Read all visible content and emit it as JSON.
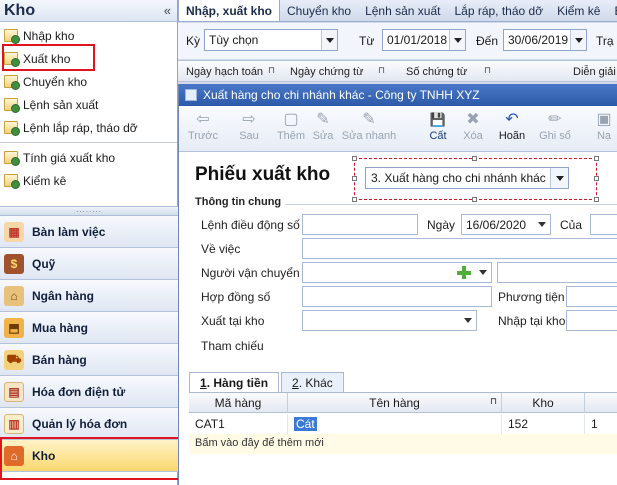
{
  "sidebar": {
    "title": "Kho",
    "collapse": "«",
    "items": [
      {
        "label": "Nhập kho"
      },
      {
        "label": "Xuất kho"
      },
      {
        "label": "Chuyển kho"
      },
      {
        "label": "Lệnh sản xuất"
      },
      {
        "label": "Lệnh lắp ráp, tháo dỡ"
      },
      {
        "label": "Tính giá xuất kho"
      },
      {
        "label": "Kiểm kê"
      }
    ],
    "grip": "........",
    "nav": [
      {
        "label": "Bàn làm việc"
      },
      {
        "label": "Quỹ"
      },
      {
        "label": "Ngân hàng"
      },
      {
        "label": "Mua hàng"
      },
      {
        "label": "Bán hàng"
      },
      {
        "label": "Hóa đơn điện tử"
      },
      {
        "label": "Quản lý hóa đơn"
      },
      {
        "label": "Kho"
      }
    ]
  },
  "tabs": [
    "Nhập, xuất kho",
    "Chuyển kho",
    "Lệnh sản xuất",
    "Lắp ráp, tháo dỡ",
    "Kiểm kê",
    "Báo"
  ],
  "filter": {
    "period_label": "Kỳ",
    "period_value": "Tùy chọn",
    "from_label": "Từ",
    "from_value": "01/01/2018",
    "to_label": "Đến",
    "to_value": "30/06/2019",
    "status_label": "Trạ"
  },
  "grid_headers": [
    "Ngày hạch toán",
    "Ngày chứng từ",
    "Số chứng từ",
    "Diễn giải"
  ],
  "form": {
    "window_title": "Xuất hàng cho chi nhánh khác - Công ty TNHH XYZ",
    "toolbar": [
      {
        "label": "Trước",
        "glyph": "⇦"
      },
      {
        "label": "Sau",
        "glyph": "⇨"
      },
      {
        "label": "Thêm",
        "glyph": "▢"
      },
      {
        "label": "Sửa",
        "glyph": "✎"
      },
      {
        "label": "Sửa nhanh",
        "glyph": "✎"
      },
      {
        "label": "Cất",
        "glyph": "💾"
      },
      {
        "label": "Xóa",
        "glyph": "✖"
      },
      {
        "label": "Hoãn",
        "glyph": "↶"
      },
      {
        "label": "Ghi sổ",
        "glyph": "✏"
      },
      {
        "label": "Nạ",
        "glyph": "▣"
      }
    ],
    "heading": "Phiếu xuất kho",
    "type_value": "3. Xuất hàng cho chi nhánh khác",
    "section_title": "Thông tin chung",
    "fields": {
      "order_label": "Lệnh điều động số",
      "date_label": "Ngày",
      "date_value": "16/06/2020",
      "of_label": "Của",
      "subject_label": "Về việc",
      "carrier_label": "Người vận chuyển",
      "contract_label": "Hợp đồng số",
      "vehicle_label": "Phương tiện",
      "from_stock_label": "Xuất tại kho",
      "to_stock_label": "Nhập tại kho",
      "reference_label": "Tham chiếu"
    },
    "detail_tabs": [
      {
        "num": "1",
        "label": ". Hàng tiền"
      },
      {
        "num": "2",
        "label": ". Khác"
      }
    ],
    "detail_columns": [
      "Mã hàng",
      "Tên hàng",
      "Kho",
      ""
    ],
    "detail_rows": [
      {
        "code": "CAT1",
        "name": "Cát",
        "stock": "152",
        "extra": "1"
      }
    ],
    "new_row_hint": "Bấm vào đây để thêm mới"
  }
}
